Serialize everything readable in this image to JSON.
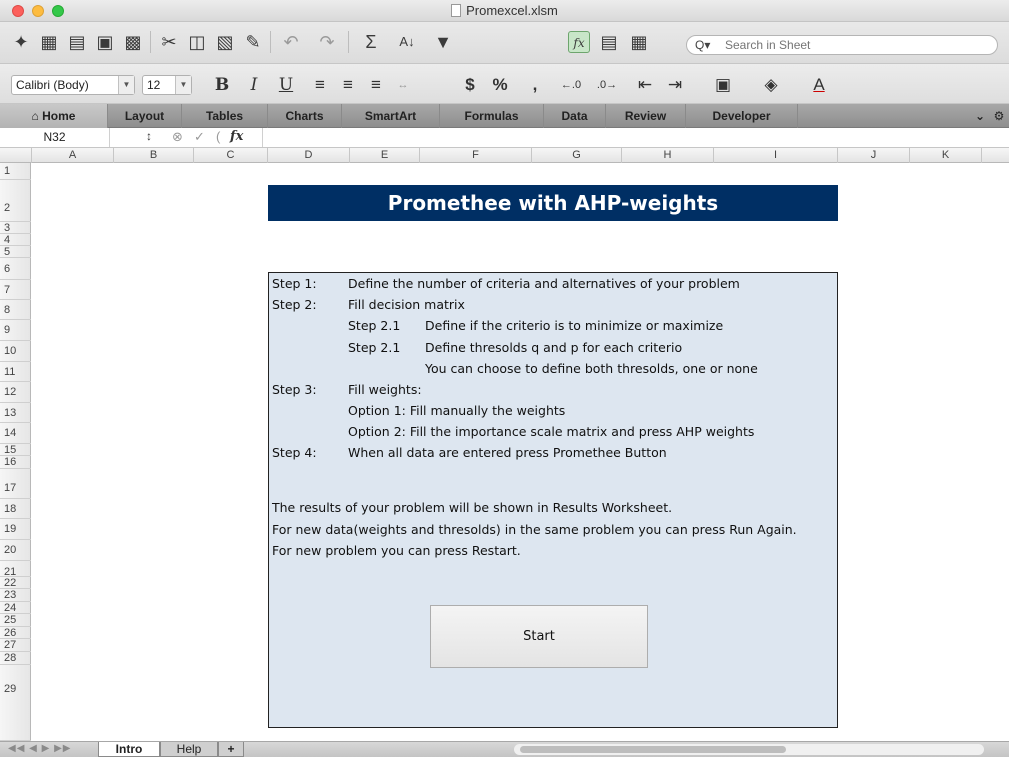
{
  "window": {
    "title": "Promexcel.xlsm"
  },
  "toolbar": {
    "icons": [
      "new-icon",
      "gallery-icon",
      "open-icon",
      "save-icon",
      "print-icon",
      "cut-icon",
      "copy-icon",
      "paste-icon",
      "format-painter-icon",
      "undo-icon",
      "redo-icon",
      "autosum-icon",
      "sort-icon",
      "filter-icon",
      "formula-builder-icon",
      "show-hide-icon",
      "toolbox-icon"
    ],
    "fx_label": "fx",
    "search_placeholder": "Search in Sheet"
  },
  "format_bar": {
    "font_name": "Calibri (Body)",
    "font_size": "12",
    "bold": "B",
    "italic": "I",
    "underline": "U",
    "currency": "$",
    "percent": "%",
    "comma": ",",
    "text_color_label": "A"
  },
  "ribbon": {
    "tabs": [
      "Home",
      "Layout",
      "Tables",
      "Charts",
      "SmartArt",
      "Formulas",
      "Data",
      "Review",
      "Developer"
    ],
    "active_tab": "Home"
  },
  "formula_bar": {
    "cell_ref": "N32",
    "fx_label": "fx",
    "formula": ""
  },
  "grid": {
    "columns": [
      "A",
      "B",
      "C",
      "D",
      "E",
      "F",
      "G",
      "H",
      "I",
      "J",
      "K"
    ],
    "rows": [
      "1",
      "2",
      "3",
      "4",
      "5",
      "6",
      "7",
      "8",
      "9",
      "10",
      "11",
      "12",
      "13",
      "14",
      "15",
      "16",
      "17",
      "18",
      "19",
      "20",
      "21",
      "22",
      "23",
      "24",
      "25",
      "26",
      "27",
      "28",
      "29"
    ]
  },
  "sheet": {
    "banner_title": "Promethee with AHP-weights",
    "steps": [
      {
        "label": "Step 1:",
        "text": "Define the number of criteria and alternatives of your problem"
      },
      {
        "label": "Step 2:",
        "text": "Fill decision matrix"
      },
      {
        "label": "Step 2.1",
        "text": "Define if the criterio is to minimize or maximize"
      },
      {
        "label": "Step 2.1",
        "text": "Define thresolds q and p for each criterio"
      },
      {
        "label": "",
        "text": "You can choose to define both thresolds, one or none"
      },
      {
        "label": "Step 3:",
        "text": "Fill weights:"
      },
      {
        "label": "",
        "text": "Option 1: Fill manually the weights"
      },
      {
        "label": "",
        "text": "Option 2: Fill the importance scale matrix and press AHP weights"
      },
      {
        "label": "Step 4:",
        "text": "When all data are entered press Promethee Button"
      }
    ],
    "notes": [
      "The results of your problem will be shown in Results Worksheet.",
      "For new data(weights and thresolds) in the same problem you can press Run Again.",
      "For new problem you can press Restart."
    ],
    "start_button": "Start"
  },
  "sheet_tabs": {
    "tabs": [
      "Intro",
      "Help"
    ],
    "active": "Intro",
    "add_label": "+"
  }
}
